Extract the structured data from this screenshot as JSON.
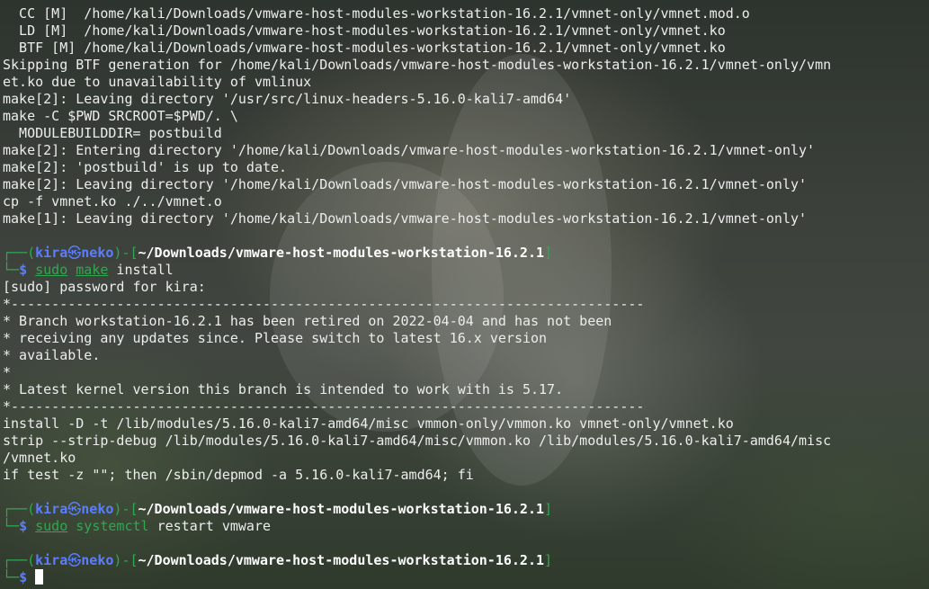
{
  "terminal": {
    "output_lines": [
      "  CC [M]  /home/kali/Downloads/vmware-host-modules-workstation-16.2.1/vmnet-only/vmnet.mod.o",
      "  LD [M]  /home/kali/Downloads/vmware-host-modules-workstation-16.2.1/vmnet-only/vmnet.ko",
      "  BTF [M] /home/kali/Downloads/vmware-host-modules-workstation-16.2.1/vmnet-only/vmnet.ko",
      "Skipping BTF generation for /home/kali/Downloads/vmware-host-modules-workstation-16.2.1/vmnet-only/vmn",
      "et.ko due to unavailability of vmlinux",
      "make[2]: Leaving directory '/usr/src/linux-headers-5.16.0-kali7-amd64'",
      "make -C $PWD SRCROOT=$PWD/. \\",
      "  MODULEBUILDDIR= postbuild",
      "make[2]: Entering directory '/home/kali/Downloads/vmware-host-modules-workstation-16.2.1/vmnet-only'",
      "make[2]: 'postbuild' is up to date.",
      "make[2]: Leaving directory '/home/kali/Downloads/vmware-host-modules-workstation-16.2.1/vmnet-only'",
      "cp -f vmnet.ko ./../vmnet.o",
      "make[1]: Leaving directory '/home/kali/Downloads/vmware-host-modules-workstation-16.2.1/vmnet-only'"
    ],
    "prompt": {
      "user": "kira",
      "host": "neko",
      "skull": "㉿",
      "cwd": "~/Downloads/vmware-host-modules-workstation-16.2.1"
    },
    "commands": [
      {
        "sudo": "sudo",
        "program": "make",
        "args": " install",
        "output_lines": [
          "[sudo] password for kira:",
          "*------------------------------------------------------------------------------",
          "* Branch workstation-16.2.1 has been retired on 2022-04-04 and has not been",
          "* receiving any updates since. Please switch to latest 16.x version",
          "* available.",
          "*",
          "* Latest kernel version this branch is intended to work with is 5.17.",
          "*------------------------------------------------------------------------------",
          "install -D -t /lib/modules/5.16.0-kali7-amd64/misc vmmon-only/vmmon.ko vmnet-only/vmnet.ko",
          "strip --strip-debug /lib/modules/5.16.0-kali7-amd64/misc/vmmon.ko /lib/modules/5.16.0-kali7-amd64/misc",
          "/vmnet.ko",
          "if test -z \"\"; then /sbin/depmod -a 5.16.0-kali7-amd64; fi"
        ]
      },
      {
        "sudo": "sudo",
        "program": "systemctl",
        "args": " restart vmware",
        "output_lines": []
      }
    ],
    "prompt_symbol": "$"
  },
  "colors": {
    "prompt_green": "#2fa84f",
    "user_host_blue": "#5b7dff",
    "text": "#ededed"
  }
}
